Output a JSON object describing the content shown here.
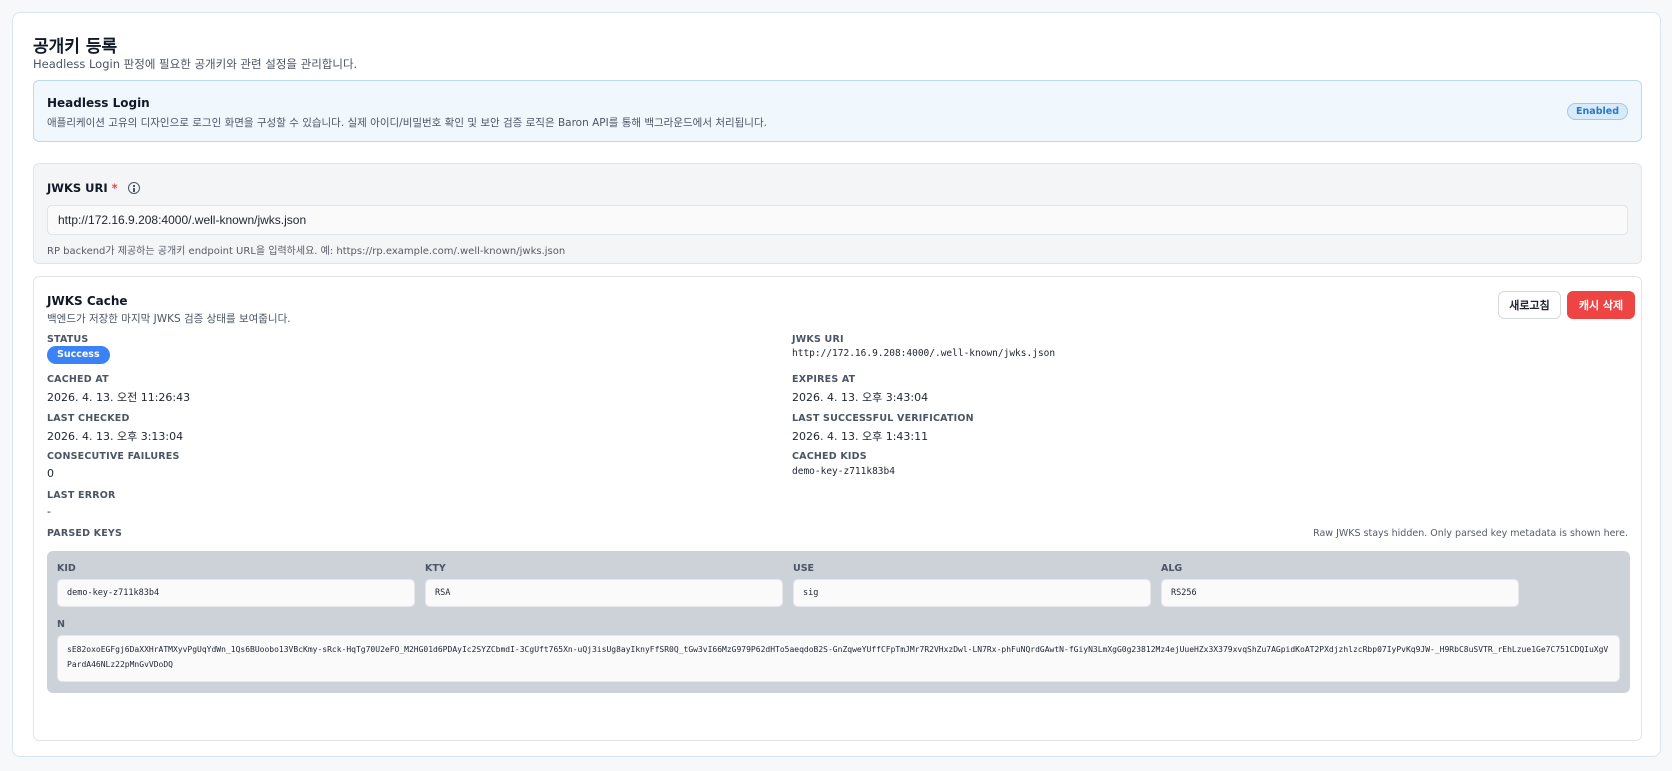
{
  "page": {
    "title": "공개키 등록",
    "subtitle": "Headless Login 판정에 필요한 공개키와 관련 설정을 관리합니다."
  },
  "headless": {
    "title": "Headless Login",
    "description": "애플리케이션 고유의 디자인으로 로그인 화면을 구성할 수 있습니다. 실제 아이디/비밀번호 확인 및 보안 검증 로직은 Baron API를 통해 백그라운드에서 처리됩니다.",
    "badge": "Enabled"
  },
  "jwks_uri_field": {
    "label": "JWKS URI",
    "required_mark": "*",
    "value": "http://172.16.9.208:4000/.well-known/jwks.json",
    "help": "RP backend가 제공하는 공개키 endpoint URL을 입력하세요. 예: https://rp.example.com/.well-known/jwks.json"
  },
  "cache": {
    "title": "JWKS Cache",
    "description": "백엔드가 저장한 마지막 JWKS 검증 상태를 보여줍니다.",
    "refresh_label": "새로고침",
    "delete_label": "캐시 삭제",
    "status_label": "STATUS",
    "status_value": "Success",
    "jwks_uri_label": "JWKS URI",
    "jwks_uri_value": "http://172.16.9.208:4000/.well-known/jwks.json",
    "cached_at_label": "CACHED AT",
    "cached_at_value": "2026. 4. 13. 오전 11:26:43",
    "expires_at_label": "EXPIRES AT",
    "expires_at_value": "2026. 4. 13. 오후 3:43:04",
    "last_checked_label": "LAST CHECKED",
    "last_checked_value": "2026. 4. 13. 오후 3:13:04",
    "last_success_label": "LAST SUCCESSFUL VERIFICATION",
    "last_success_value": "2026. 4. 13. 오후 1:43:11",
    "failures_label": "CONSECUTIVE FAILURES",
    "failures_value": "0",
    "kids_label": "CACHED KIDS",
    "kids_value": "demo-key-z711k83b4",
    "last_error_label": "LAST ERROR",
    "last_error_value": "-",
    "parsed_keys_label": "PARSED KEYS",
    "parsed_keys_note": "Raw JWKS stays hidden. Only parsed key metadata is shown here."
  },
  "parsed_key": {
    "kid_label": "KID",
    "kid": "demo-key-z711k83b4",
    "kty_label": "KTY",
    "kty": "RSA",
    "use_label": "USE",
    "use": "sig",
    "alg_label": "ALG",
    "alg": "RS256",
    "n_label": "N",
    "n": "sE82oxoEGFgj6DaXXHrATMXyvPgUqYdWn_1Qs6BUoobo13VBcKmy-sRck-HqTg70U2eFO_M2HG01d6PDAyIc2SYZCbmdI-3CgUft765Xn-uQj3isUg8ayIknyFfSR0Q_tGw3vI66MzG979P62dHTo5aeqdoB2S-GnZqweYUffCFpTmJMr7R2VHxzDwl-LN7Rx-phFuNQrdGAwtN-fGiyN3LmXgG0g23812Mz4ejUueHZx3X379xvqShZu7AGpidKoAT2PXdjzhlzcRbp07IyPvKq9JW-_H9RbC8uSVTR_rEhLzue1Ge7C751CDQIuXgVPardA46NLz22pMnGvVDoDQ"
  }
}
